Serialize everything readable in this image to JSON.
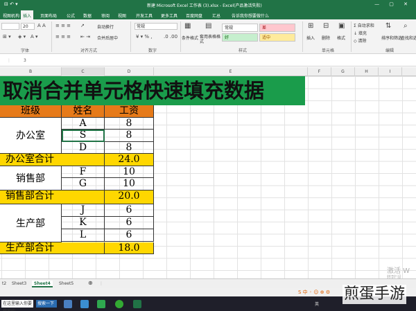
{
  "window": {
    "title": "新建 Microsoft Excel 工作表 (3).xlsx - Excel(产品激活失败)"
  },
  "ribbon_tabs": [
    "视图机构",
    "插入",
    "页面布局",
    "公式",
    "数据",
    "审阅",
    "视图",
    "开发工具",
    "更多工具",
    "百度网盘",
    "汇总",
    "告诉我你想要做什么"
  ],
  "ribbon": {
    "font_size": "20",
    "number_format": "常规",
    "wrap_text": "自动换行",
    "merge_center": "合并后居中",
    "conditional_format": "条件格式",
    "format_as_table": "套用表格格式",
    "styles": {
      "bad": "差",
      "good": "好",
      "normal": "常规",
      "neutral": "适中"
    },
    "insert": "插入",
    "delete": "删除",
    "format": "格式",
    "autosum": "自动求和",
    "fill": "填充",
    "clear": "清除",
    "sort_filter": "排序和筛选",
    "find_select": "查找和选择",
    "groups": {
      "font": "字体",
      "alignment": "对齐方式",
      "number": "数字",
      "styles": "样式",
      "cells": "单元格",
      "editing": "编辑"
    }
  },
  "formula_bar": {
    "value": "3"
  },
  "columns": [
    "B",
    "C",
    "D",
    "E",
    "F",
    "G",
    "H",
    "I"
  ],
  "banner": {
    "title": "取消合并单元格快速填充数据"
  },
  "table": {
    "headers": [
      "班级",
      "姓名",
      "工资"
    ],
    "groups": [
      {
        "dept": "办公室",
        "rows": [
          [
            "A",
            "8"
          ],
          [
            "S",
            "8"
          ],
          [
            "D",
            "8"
          ]
        ],
        "total_label": "办公室合计",
        "total": "24.0"
      },
      {
        "dept": "销售部",
        "rows": [
          [
            "F",
            "10"
          ],
          [
            "G",
            "10"
          ]
        ],
        "total_label": "销售部合计",
        "total": "20.0"
      },
      {
        "dept": "生产部",
        "rows": [
          [
            "J",
            "6"
          ],
          [
            "K",
            "6"
          ],
          [
            "L",
            "6"
          ]
        ],
        "total_label": "生产部合计",
        "total": "18.0"
      }
    ]
  },
  "sheet_tabs": [
    "t2",
    "Sheet3",
    "Sheet4",
    "Sheet5"
  ],
  "active_sheet": "Sheet4",
  "watermark": {
    "line1": "激活 W",
    "line2": "转到\"设"
  },
  "taskbar": {
    "search": "在这里输入你要搜索的",
    "search_btn": "搜索一下",
    "tray_text": "英"
  },
  "logo": "煎蛋手游"
}
